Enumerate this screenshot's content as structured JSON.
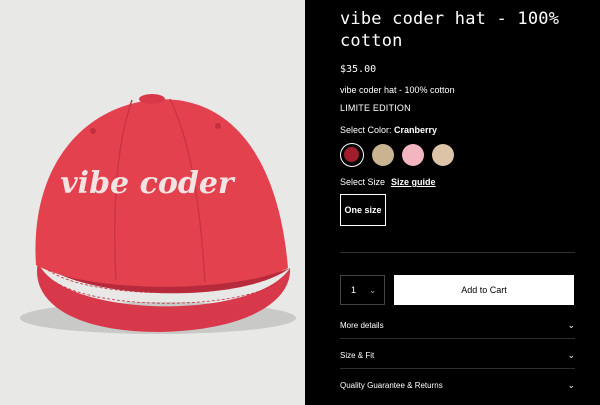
{
  "product": {
    "image_text": "vibe coder",
    "title": "vibe coder hat - 100% cotton",
    "price": "$35.00",
    "subtitle": "vibe coder hat - 100% cotton",
    "edition": "LIMITE EDITION"
  },
  "color": {
    "label": "Select Color:",
    "selected": "Cranberry",
    "swatches": [
      {
        "name": "Cranberry",
        "hex": "#a11d2c",
        "selected": true
      },
      {
        "name": "Khaki",
        "hex": "#c9b391",
        "selected": false
      },
      {
        "name": "Pink",
        "hex": "#f3b5c0",
        "selected": false
      },
      {
        "name": "Sand",
        "hex": "#ddc3a8",
        "selected": false
      }
    ]
  },
  "size": {
    "label": "Select Size",
    "guide_label": "Size guide",
    "option": "One size"
  },
  "purchase": {
    "quantity": "1",
    "cart_label": "Add to Cart"
  },
  "accordions": [
    {
      "label": "More details"
    },
    {
      "label": "Size & Fit"
    },
    {
      "label": "Quality Guarantee & Returns"
    }
  ],
  "colors": {
    "cap": "#e4414f",
    "background_image": "#e8e8e6",
    "panel": "#000000"
  }
}
